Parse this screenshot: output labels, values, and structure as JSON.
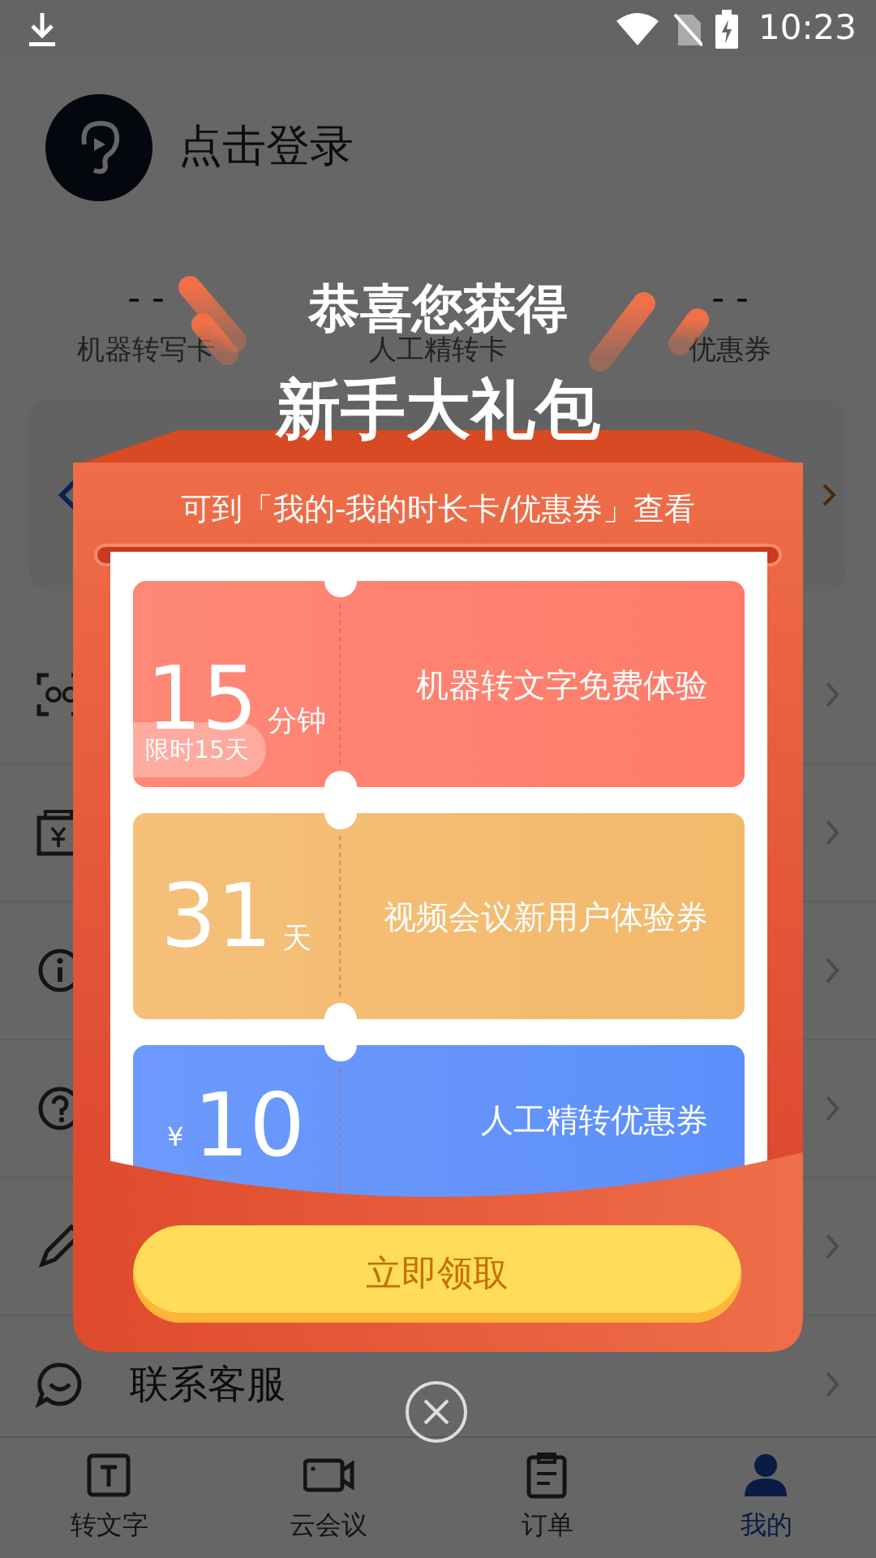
{
  "status_bar": {
    "time": "10:23"
  },
  "profile": {
    "login_text": "点击登录"
  },
  "stats": [
    {
      "value": "- -",
      "label": "机器转写卡"
    },
    {
      "label": "人工精转卡"
    },
    {
      "value": "- -",
      "label": "优惠券"
    }
  ],
  "menu": [
    {
      "label": "联系客服"
    }
  ],
  "popup": {
    "title": "恭喜您获得",
    "subtitle": "新手大礼包",
    "hint": "可到「我的-我的时长卡/优惠券」查看",
    "tickets": [
      {
        "amount": "15",
        "unit": "分钟",
        "badge": "限时15天",
        "description": "机器转文字免费体验",
        "color": "#ff7b69"
      },
      {
        "amount": "31",
        "unit": "天",
        "description": "视频会议新用户体验券",
        "color": "#f3b96b"
      },
      {
        "prefix": "¥",
        "amount": "10",
        "description": "人工精转优惠券",
        "color": "#5d8ffb"
      }
    ],
    "button": "立即领取"
  },
  "tabs": [
    {
      "label": "转文字",
      "selected": false
    },
    {
      "label": "云会议",
      "selected": false
    },
    {
      "label": "订单",
      "selected": false
    },
    {
      "label": "我的",
      "selected": true
    }
  ]
}
